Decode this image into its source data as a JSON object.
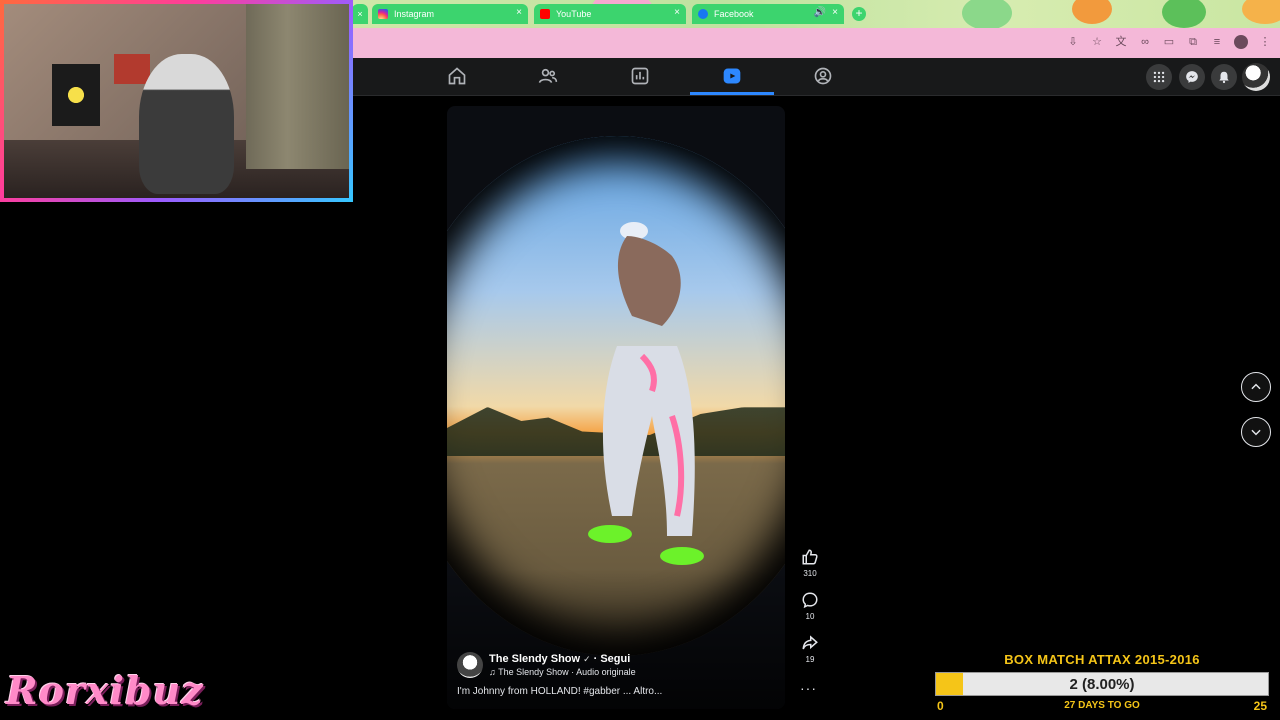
{
  "browser": {
    "tabs": [
      {
        "label": "Instagram",
        "favicon": "instagram-icon",
        "color": "#e1306c"
      },
      {
        "label": "YouTube",
        "favicon": "youtube-icon",
        "color": "#ff0000"
      },
      {
        "label": "Facebook",
        "favicon": "facebook-icon",
        "color": "#1877f2",
        "active": true
      }
    ],
    "close_glyph": "×",
    "new_tab_glyph": "+",
    "address_icons": [
      "install-icon",
      "bookmark-star-icon",
      "translate-icon",
      "link-icon",
      "reader-icon",
      "extension-icon",
      "settings-icon",
      "profile-icon",
      "menu-icon"
    ]
  },
  "fb_nav": {
    "items": [
      "home-icon",
      "friends-icon",
      "dashboard-icon",
      "reels-icon",
      "groups-icon"
    ],
    "active": "reels-icon",
    "right": [
      "apps-grid-icon",
      "messenger-icon",
      "notifications-icon",
      "account-avatar"
    ]
  },
  "streamer": {
    "name": "Rorxibuz"
  },
  "reel": {
    "page_name": "The Slendy Show",
    "verified_glyph": "✓",
    "follow_label": "· Segui",
    "audio_label": "♫ The Slendy Show · Audio originale",
    "caption": "I'm Johnny from HOLLAND! #gabber ... Altro...",
    "actions": [
      {
        "icon": "like-icon",
        "count": "310"
      },
      {
        "icon": "comment-icon",
        "count": "10"
      },
      {
        "icon": "share-icon",
        "count": "19"
      }
    ],
    "more_glyph": "···"
  },
  "goal": {
    "title": "BOX MATCH ATTAX 2015-2016",
    "current_text": "2 (8.00%)",
    "progress_fraction": 0.08,
    "min": "0",
    "max": "25",
    "days_left": "27 DAYS TO GO"
  },
  "colors": {
    "fb_accent": "#2d88ff",
    "goal_yellow": "#f5c518",
    "address_pink": "#f4b8d8"
  }
}
